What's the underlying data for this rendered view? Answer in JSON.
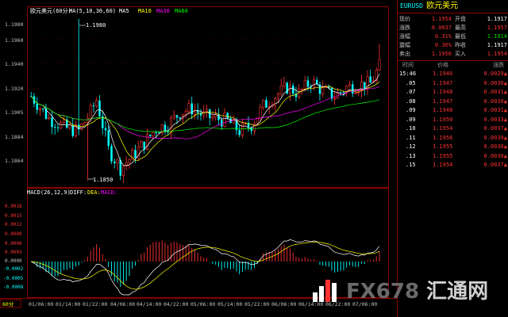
{
  "chart": {
    "title": "欧元美元(60分)",
    "ma_label": "MA(5,10,30,60)",
    "ma_items": [
      {
        "label": "MA5",
        "color": "#ffffff"
      },
      {
        "label": "MA10",
        "color": "#ffff00"
      },
      {
        "label": "MA30",
        "color": "#ff00ff"
      },
      {
        "label": "MA60",
        "color": "#00ff00"
      }
    ],
    "price_axis": [
      "1.1980",
      "1.1960",
      "1.1940",
      "1.1920",
      "1.1905",
      "1.1884",
      "1.1864"
    ],
    "high_label": "1.1980",
    "low_label": "1.1850",
    "macd_label": "MACD(26,12,9)",
    "macd_items": [
      {
        "label": "DIFF:",
        "color": "#ffffff"
      },
      {
        "label": "DEA:",
        "color": "#ffff00"
      },
      {
        "label": "MACD:",
        "color": "#ff00ff"
      }
    ],
    "macd_axis": [
      "0.0018",
      "0.0015",
      "0.0012",
      "0.0009",
      "0.0006",
      "0.0003",
      "0.0000",
      "-0.0002",
      "-0.0005",
      "-0.0008"
    ],
    "period_label": "60分",
    "dates": [
      "01/06:00",
      "01/14:00",
      "01/22:00",
      "04/06:00",
      "04/14:00",
      "04/22:00",
      "05/06:00",
      "05/14:00",
      "05/22:00",
      "06/06:00",
      "06/14:00",
      "06/22:00",
      "07/06:00"
    ],
    "colors": {
      "up": "#ff3232",
      "down": "#00ffff",
      "frame": "#8b0000",
      "axis_text": "#c0c0c0"
    }
  },
  "panel": {
    "code": "EURUSD",
    "name": "欧元美元",
    "quotes": [
      {
        "l1": "现价",
        "v1": "1.1954",
        "c1": "red",
        "l2": "开盘",
        "v2": "1.1917",
        "c2": "white"
      },
      {
        "l1": "涨跌",
        "v1": "0.0037",
        "c1": "red",
        "l2": "最高",
        "v2": "1.1957",
        "c2": "red"
      },
      {
        "l1": "涨幅",
        "v1": "0.31%",
        "c1": "red",
        "l2": "最低",
        "v2": "1.1914",
        "c2": "green"
      },
      {
        "l1": "震幅",
        "v1": "0.36%",
        "c1": "red",
        "l2": "昨收",
        "v2": "1.1917",
        "c2": "white"
      },
      {
        "l1": "卖出",
        "v1": "1.1956",
        "c1": "red",
        "l2": "买入",
        "v2": "1.1954",
        "c2": "red"
      }
    ],
    "ticks_header": {
      "time": "时间",
      "price": "价格",
      "change": "涨跌"
    },
    "ticks": [
      {
        "time": "15:46",
        "price": "1.1946",
        "change": "0.0029"
      },
      {
        "time": ".05",
        "price": "1.1947",
        "change": "0.0030"
      },
      {
        "time": ".07",
        "price": "1.1948",
        "change": "0.0031"
      },
      {
        "time": ".08",
        "price": "1.1947",
        "change": "0.0030"
      },
      {
        "time": ".09",
        "price": "1.1948",
        "change": "0.0031"
      },
      {
        "time": ".09",
        "price": "1.1950",
        "change": "0.0033"
      },
      {
        "time": ".10",
        "price": "1.1954",
        "change": "0.0037"
      },
      {
        "time": ".11",
        "price": "1.1956",
        "change": "0.0039"
      },
      {
        "time": ".12",
        "price": "1.1955",
        "change": "0.0038"
      },
      {
        "time": ".13",
        "price": "1.1955",
        "change": "0.0038"
      },
      {
        "time": ".15",
        "price": "1.1954",
        "change": "0.0037"
      }
    ]
  },
  "watermark": {
    "text": "FX678",
    "cn": "汇通网"
  }
}
